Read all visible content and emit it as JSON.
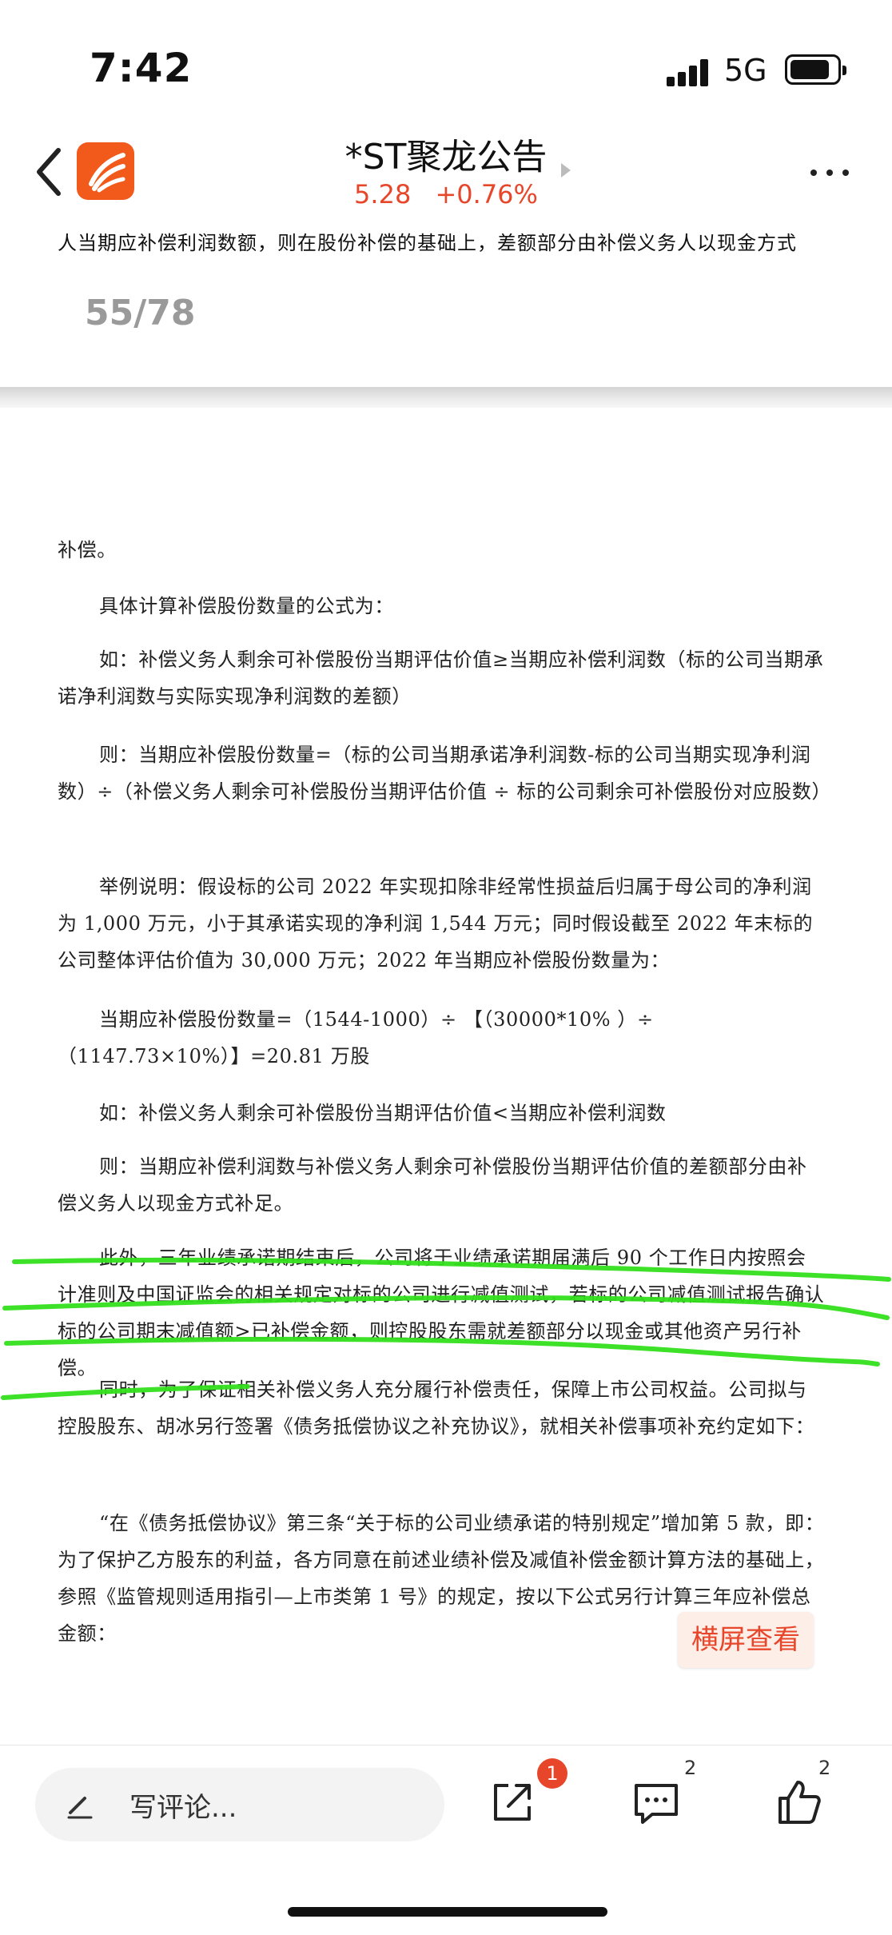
{
  "status": {
    "time": "7:42",
    "network": "5G"
  },
  "header": {
    "title": "*ST聚龙公告",
    "price": "5.28",
    "change": "+0.76%"
  },
  "prev_page": {
    "last_line": "人当期应补偿利润数额，则在股份补偿的基础上，差额部分由补偿义务人以现金方式",
    "page_indicator": "55/78"
  },
  "document": {
    "paragraphs": [
      "补偿。",
      "具体计算补偿股份数量的公式为：",
      "如：补偿义务人剩余可补偿股份当期评估价值≥当期应补偿利润数（标的公司当期承诺净利润数与实际实现净利润数的差额）",
      "则：当期应补偿股份数量=（标的公司当期承诺净利润数-标的公司当期实现净利润数）÷（补偿义务人剩余可补偿股份当期评估价值 ÷ 标的公司剩余可补偿股份对应股数）",
      "举例说明：假设标的公司 2022 年实现扣除非经常性损益后归属于母公司的净利润为 1,000 万元，小于其承诺实现的净利润 1,544 万元；同时假设截至 2022 年末标的公司整体评估价值为 30,000 万元；2022 年当期应补偿股份数量为：",
      "当期应补偿股份数量=（1544-1000）÷ 【（30000*10% ）÷（1147.73×10%）】=20.81 万股",
      "如：补偿义务人剩余可补偿股份当期评估价值<当期应补偿利润数",
      "则：当期应补偿利润数与补偿义务人剩余可补偿股份当期评估价值的差额部分由补偿义务人以现金方式补足。",
      "此外，三年业绩承诺期结束后，公司将于业绩承诺期届满后 90 个工作日内按照会计准则及中国证监会的相关规定对标的公司进行减值测试，若标的公司减值测试报告确认标的公司期末减值额>已补偿金额，则控股股东需就差额部分以现金或其他资产另行补偿。",
      "同时，为了保证相关补偿义务人充分履行补偿责任，保障上市公司权益。公司拟与控股股东、胡冰另行签署《债务抵偿协议之补充协议》，就相关补偿事项补充约定如下：",
      "“在《债务抵偿协议》第三条“关于标的公司业绩承诺的特别规定”增加第 5 款，即：为了保护乙方股东的利益，各方同意在前述业绩补偿及减值补偿金额计算方法的基础上，参照《监管规则适用指引—上市类第 1 号》的规定，按以下公式另行计算三年应补偿总金额："
    ]
  },
  "landscape_button": "横屏查看",
  "bottom_bar": {
    "comment_placeholder": "写评论...",
    "share_badge": "1",
    "comments_count": "2",
    "likes_count": "2"
  },
  "colors": {
    "accent": "#e8462a",
    "highlight": "#33e01c",
    "logo": "#f25a1c"
  }
}
